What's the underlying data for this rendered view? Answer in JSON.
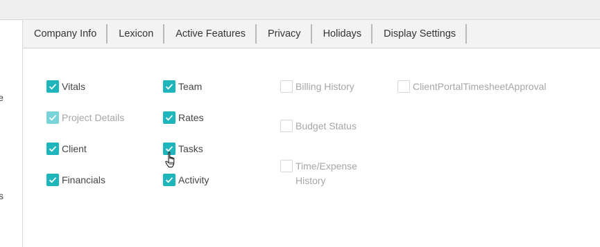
{
  "tabs": [
    {
      "label": "Company Info"
    },
    {
      "label": "Lexicon"
    },
    {
      "label": "Active Features"
    },
    {
      "label": "Privacy"
    },
    {
      "label": "Holidays"
    },
    {
      "label": "Display Settings"
    }
  ],
  "left_panel": {
    "fragments": [
      "e",
      "s"
    ]
  },
  "features": {
    "vitals": {
      "label": "Vitals",
      "checked": true,
      "enabled": true
    },
    "project_details": {
      "label": "Project Details",
      "checked": true,
      "enabled": false
    },
    "client": {
      "label": "Client",
      "checked": true,
      "enabled": true
    },
    "financials": {
      "label": "Financials",
      "checked": true,
      "enabled": true
    },
    "team": {
      "label": "Team",
      "checked": true,
      "enabled": true
    },
    "rates": {
      "label": "Rates",
      "checked": true,
      "enabled": true
    },
    "tasks": {
      "label": "Tasks",
      "checked": true,
      "enabled": true
    },
    "activity": {
      "label": "Activity",
      "checked": true,
      "enabled": true
    },
    "billing_history": {
      "label": "Billing History",
      "checked": false,
      "enabled": false
    },
    "budget_status": {
      "label": "Budget Status",
      "checked": false,
      "enabled": false
    },
    "time_expense_history": {
      "label_line1": "Time/Expense",
      "label_line2": "History",
      "checked": false,
      "enabled": false
    },
    "client_portal": {
      "label": "ClientPortalTimesheetApproval",
      "checked": false,
      "enabled": false
    }
  },
  "colors": {
    "accent": "#1fb5bd",
    "accent_disabled": "#79d4d9",
    "disabled_text": "#a6a6a6"
  },
  "icons": {
    "check": "check-icon",
    "cursor": "hand-pointer-cursor"
  }
}
